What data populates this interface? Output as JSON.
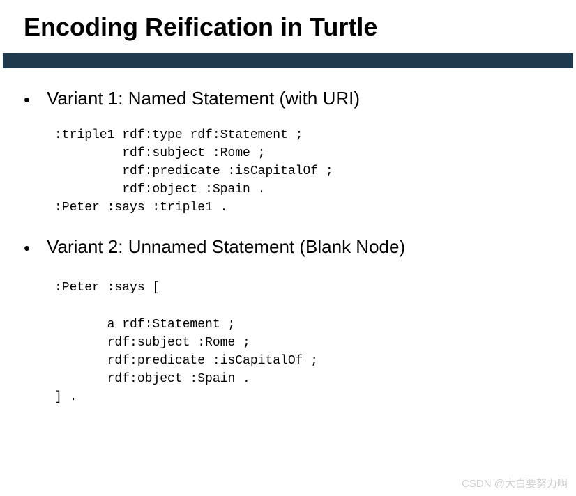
{
  "title": "Encoding Reification in Turtle",
  "bullets": {
    "variant1": "Variant 1: Named Statement (with URI)",
    "variant2": "Variant 2: Unnamed Statement (Blank Node)"
  },
  "code": {
    "block1": ":triple1 rdf:type rdf:Statement ;\n         rdf:subject :Rome ;\n         rdf:predicate :isCapitalOf ;\n         rdf:object :Spain .\n:Peter :says :triple1 .",
    "block2": ":Peter :says [\n\n       a rdf:Statement ;\n       rdf:subject :Rome ;\n       rdf:predicate :isCapitalOf ;\n       rdf:object :Spain .\n] ."
  },
  "watermark": "CSDN @大白要努力啊"
}
